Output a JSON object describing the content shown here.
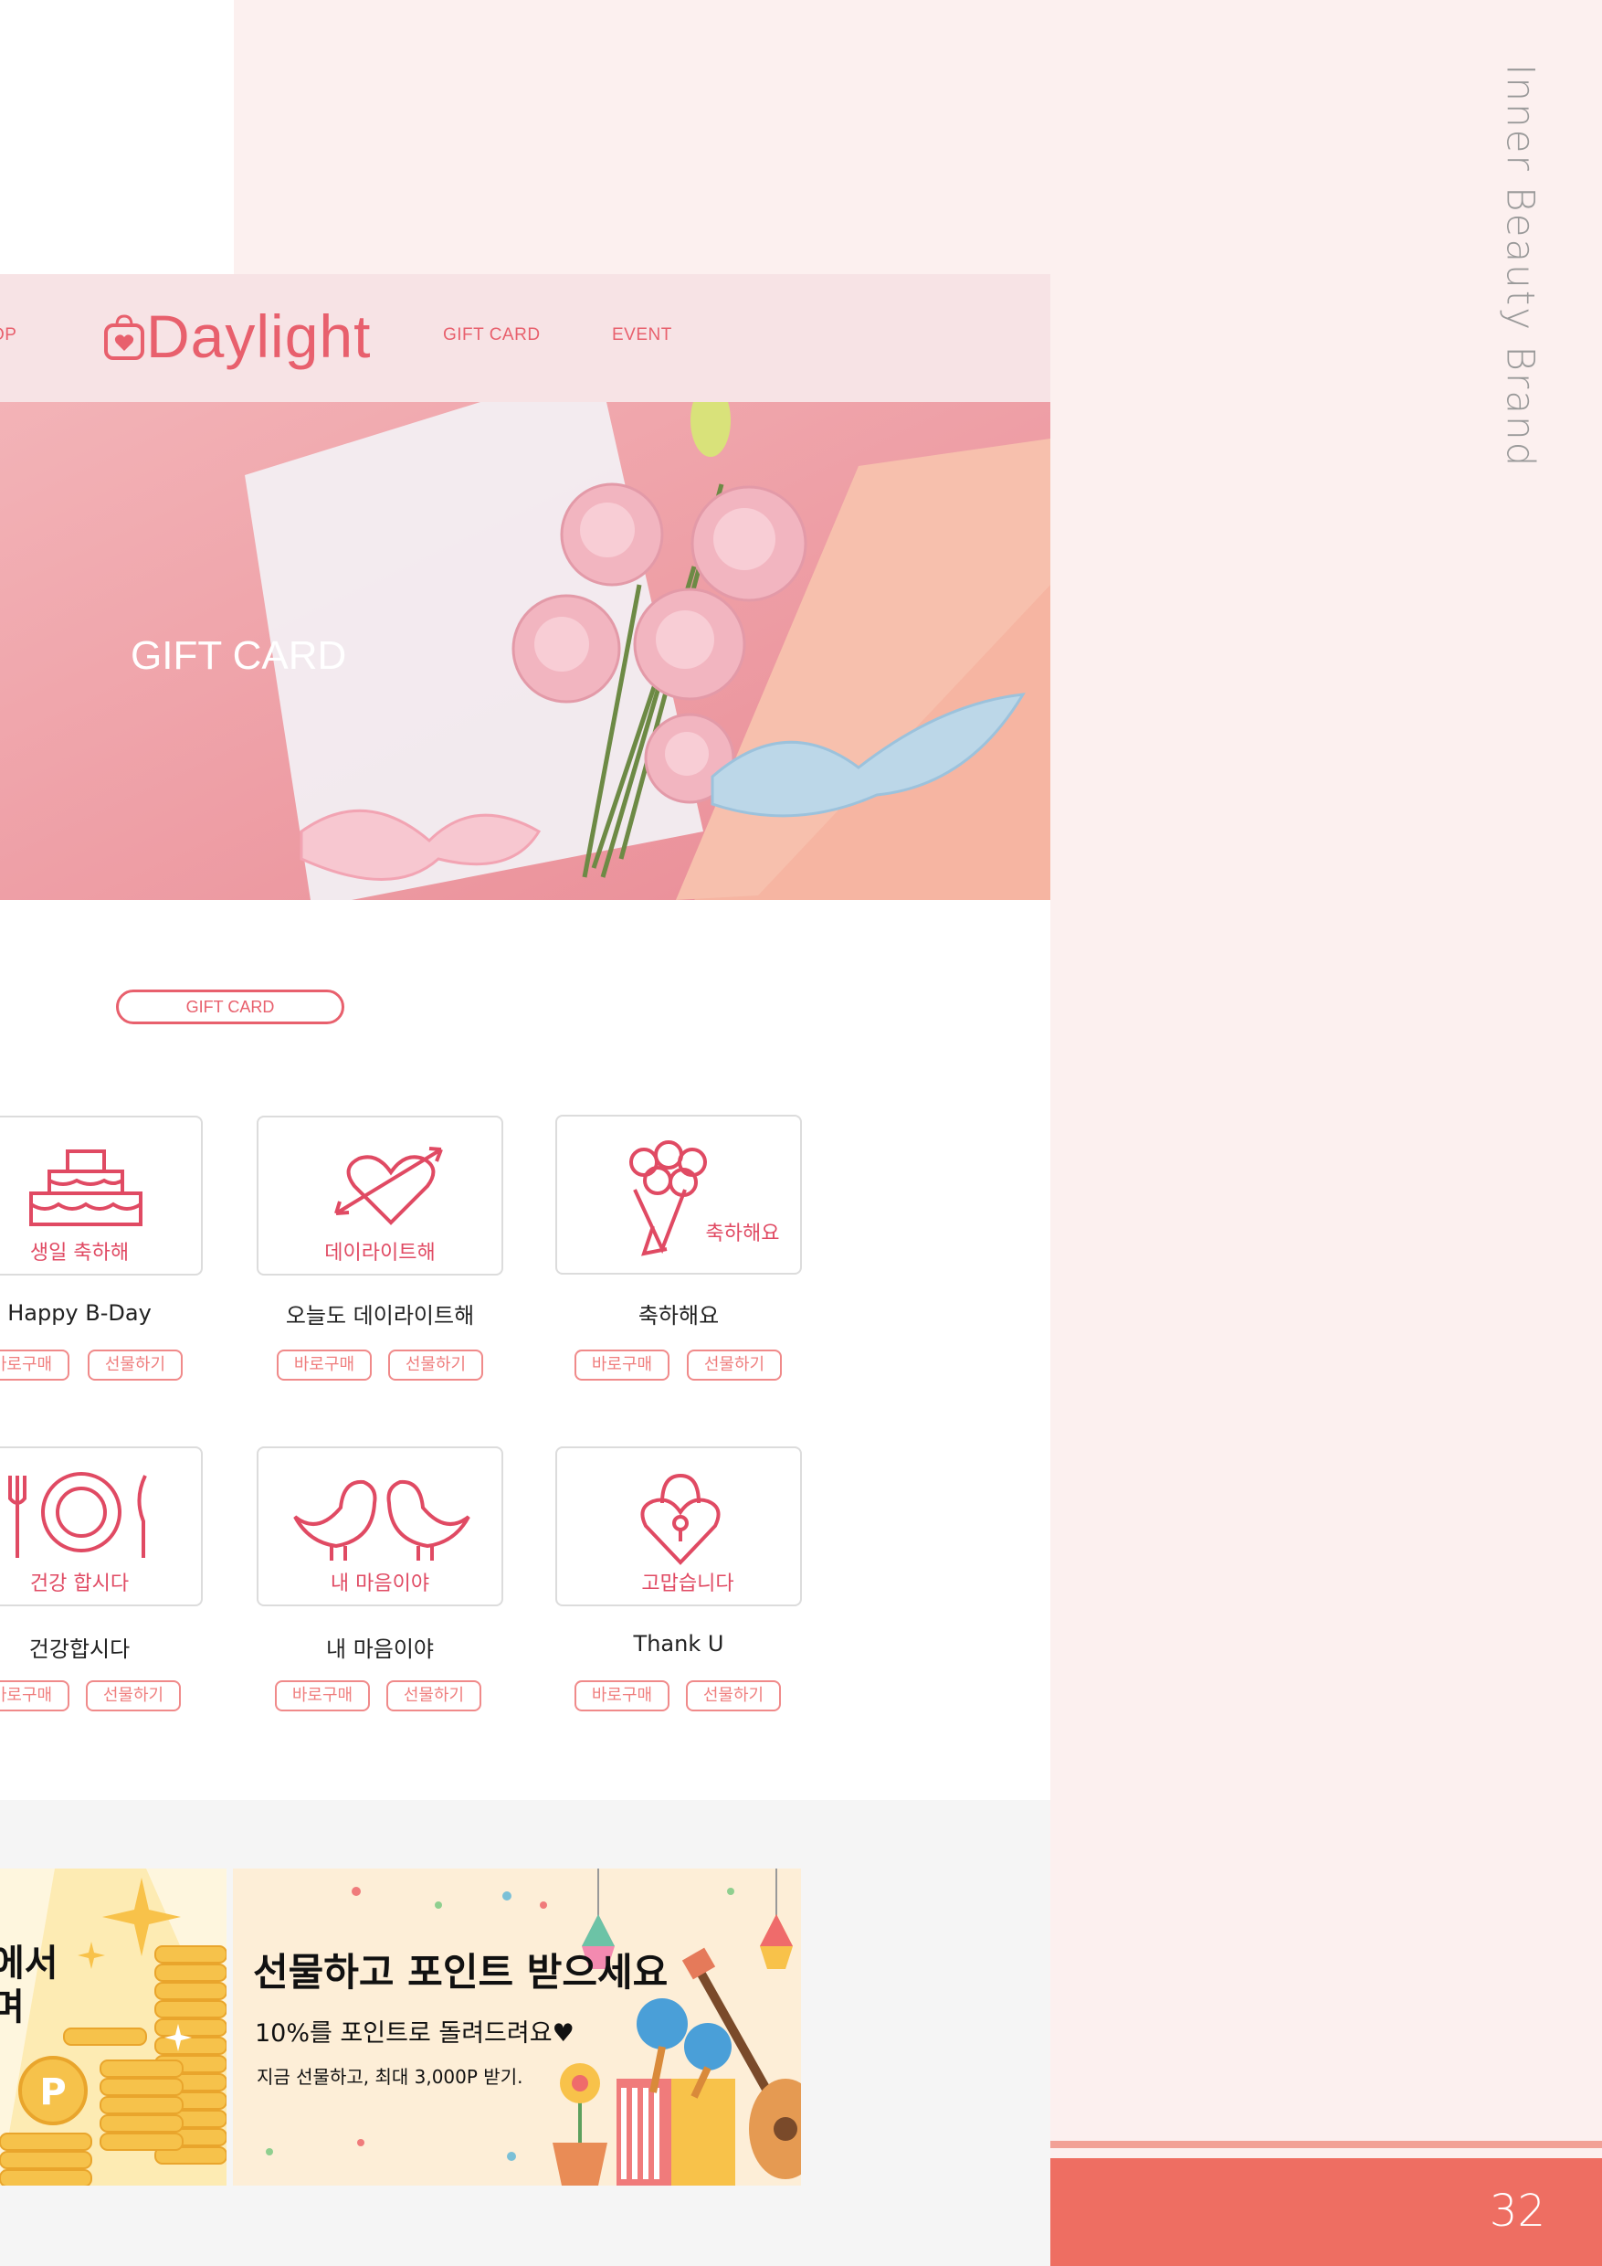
{
  "brand_vertical": "Inner Beauty Brand",
  "page_number": "32",
  "colors": {
    "accent": "#e8606d",
    "panel": "#fcf0ef",
    "footer": "#ee6e62"
  },
  "nav": {
    "shop_label": "OP",
    "logo_text": "Daylight",
    "logo_icon": "bag-heart-icon",
    "gift_card_label": "GIFT CARD",
    "event_label": "EVENT"
  },
  "hero": {
    "title": "GIFT CARD"
  },
  "section": {
    "pill_label": "GIFT CARD"
  },
  "cards": [
    {
      "name": "Happy B-Day",
      "icon": "cake-icon",
      "caption": "생일 축하해",
      "buy": "바로구매",
      "gift": "선물하기"
    },
    {
      "name": "오늘도 데이라이트해",
      "icon": "heart-arrow-icon",
      "caption": "데이라이트해",
      "buy": "바로구매",
      "gift": "선물하기"
    },
    {
      "name": "축하해요",
      "icon": "bouquet-icon",
      "caption": "축하해요",
      "buy": "바로구매",
      "gift": "선물하기"
    },
    {
      "name": "건강합시다",
      "icon": "plate-cutlery-icon",
      "caption": "건강 합시다",
      "buy": "바로구매",
      "gift": "선물하기"
    },
    {
      "name": "내 마음이야",
      "icon": "love-birds-icon",
      "caption": "내 마음이야",
      "buy": "바로구매",
      "gift": "선물하기"
    },
    {
      "name": "Thank U",
      "icon": "heart-lock-icon",
      "caption": "고맙습니다",
      "buy": "바로구매",
      "gift": "선물하기"
    }
  ],
  "promo": {
    "left_text": "에서\n며",
    "headline": "선물하고 포인트 받으세요",
    "sub": "10%를 포인트로 돌려드려요♥",
    "small": "지금 선물하고, 최대 3,000P 받기."
  }
}
